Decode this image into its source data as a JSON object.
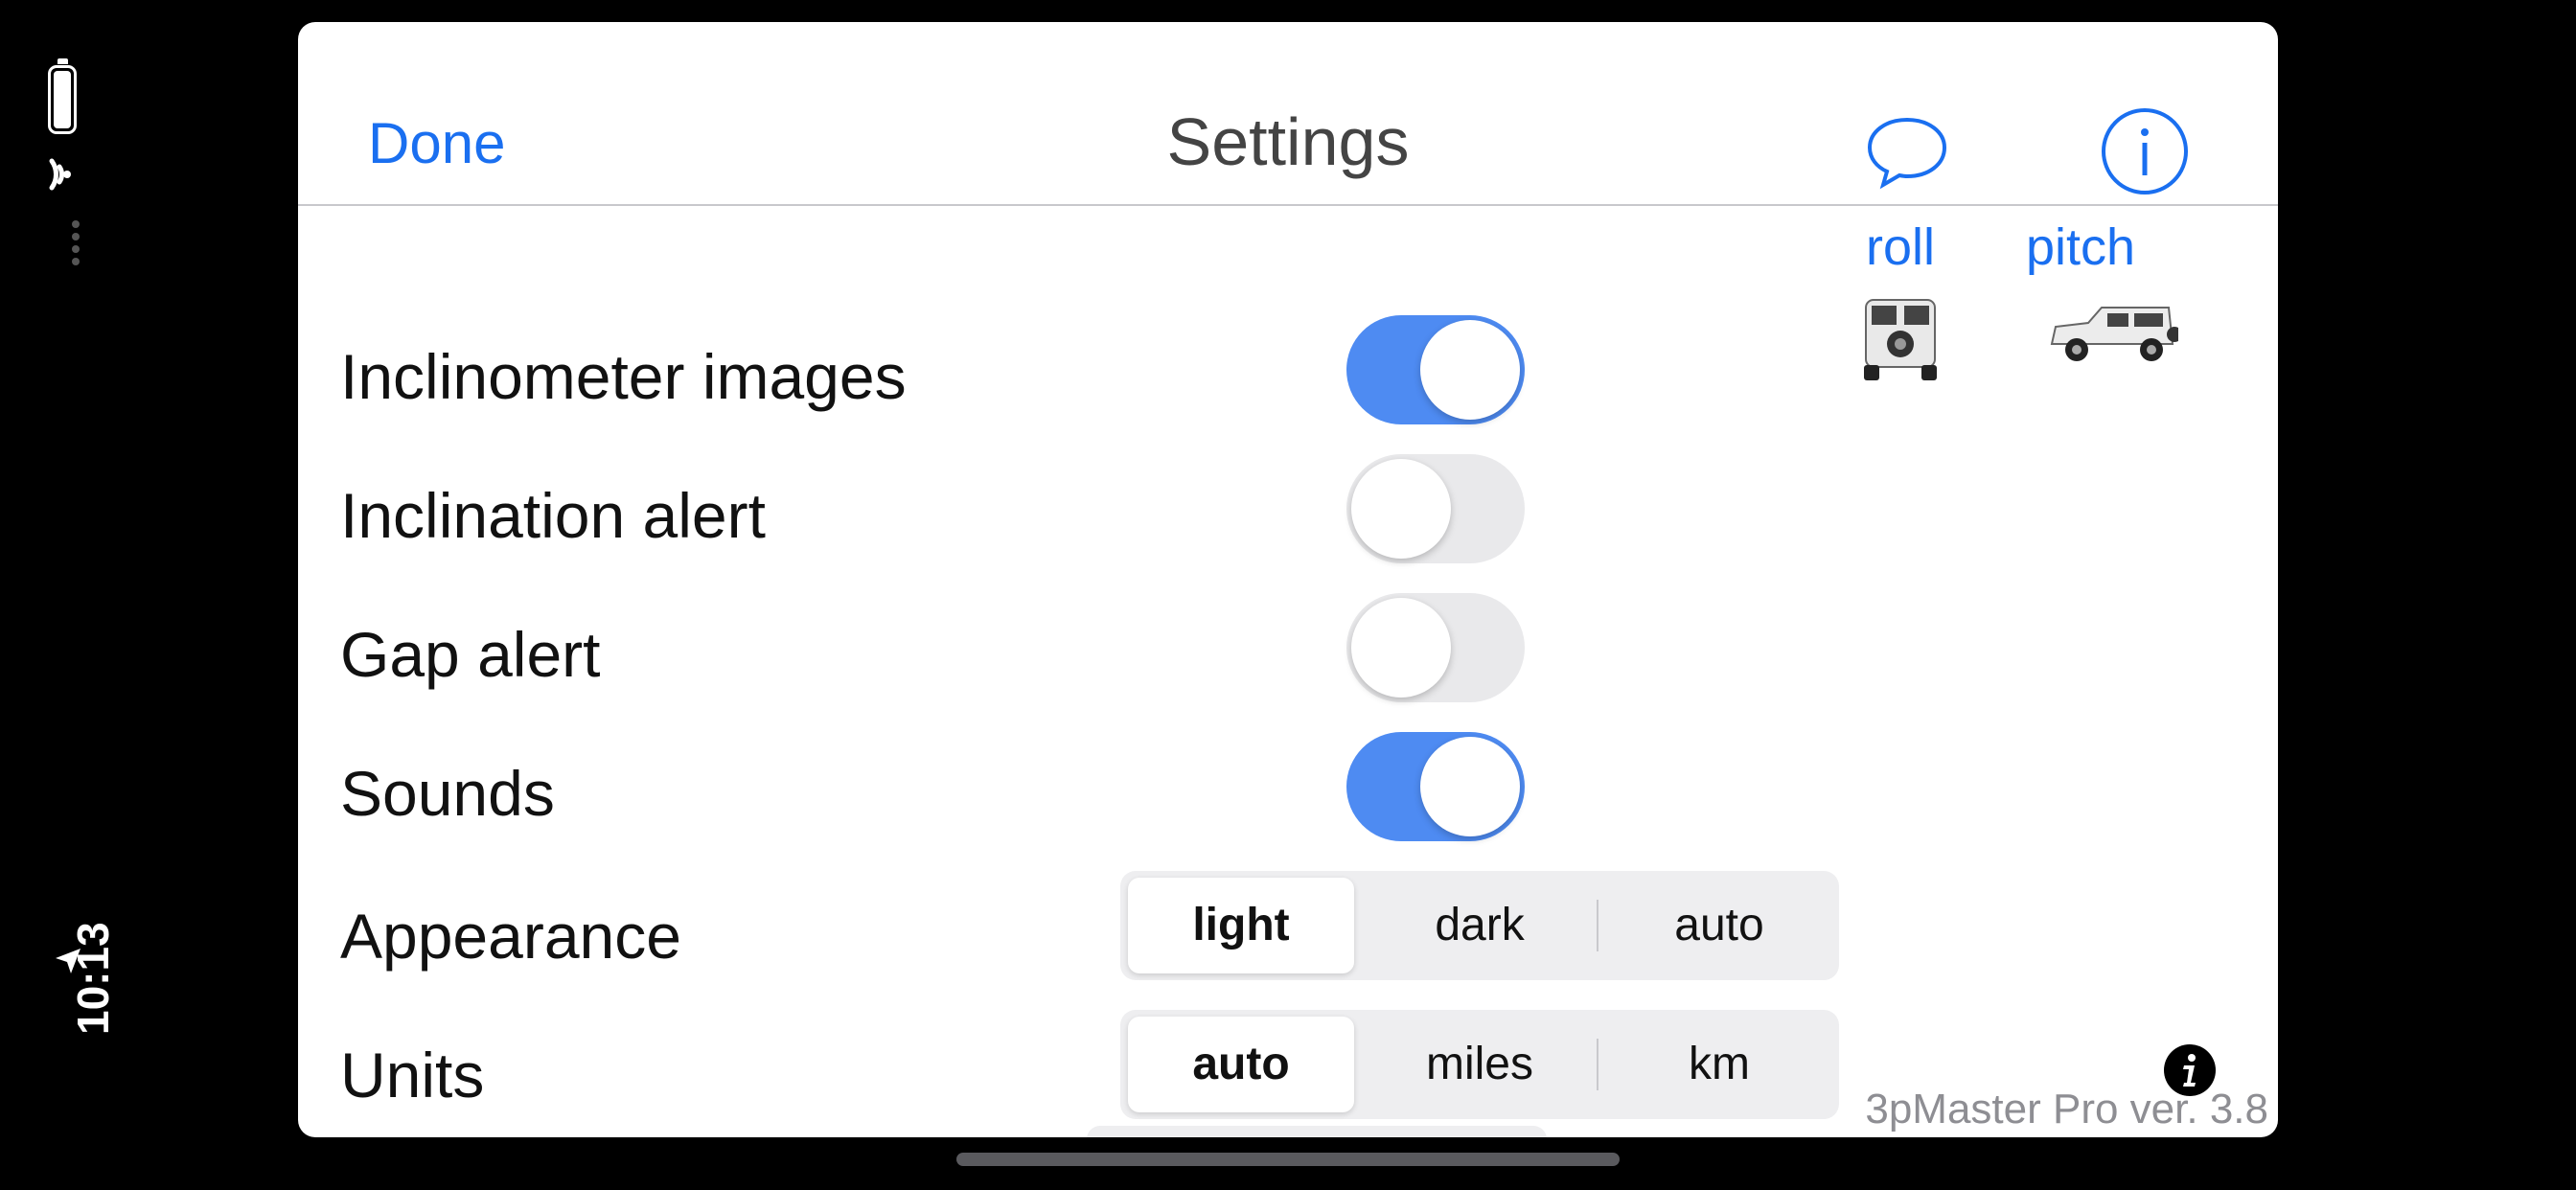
{
  "status": {
    "time": "10:13",
    "battery_icon": "battery-icon",
    "wifi_icon": "wifi-icon",
    "location_icon": "location-arrow-icon"
  },
  "nav": {
    "done_label": "Done",
    "title": "Settings",
    "chat_icon": "speech-bubble-icon",
    "info_icon": "info-circle-icon"
  },
  "settings": {
    "inclinometer_images": {
      "label": "Inclinometer images",
      "on": true
    },
    "inclination_alert": {
      "label": "Inclination alert",
      "on": false
    },
    "gap_alert": {
      "label": "Gap alert",
      "on": false
    },
    "sounds": {
      "label": "Sounds",
      "on": true
    },
    "appearance": {
      "label": "Appearance",
      "options": [
        "light",
        "dark",
        "auto"
      ],
      "selected": "light"
    },
    "units": {
      "label": "Units",
      "options": [
        "auto",
        "miles",
        "km"
      ],
      "selected": "auto"
    }
  },
  "side": {
    "roll_label": "roll",
    "pitch_label": "pitch",
    "roll_image": "suv-rear-view-icon",
    "pitch_image": "suv-side-view-icon"
  },
  "footer": {
    "version": "3pMaster Pro ver. 3.8",
    "info_icon": "info-filled-icon"
  },
  "colors": {
    "accent": "#1a6ff0",
    "toggle_on": "#4e8bf2",
    "toggle_off": "#e9e9eb",
    "background": "#000000"
  }
}
